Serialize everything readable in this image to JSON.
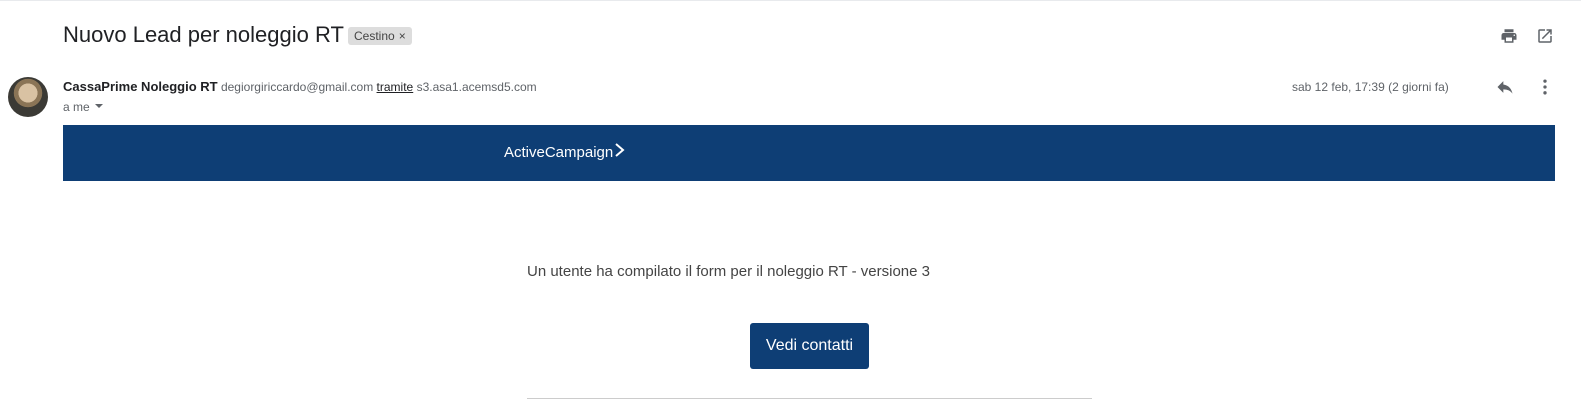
{
  "email": {
    "subject": "Nuovo Lead per noleggio RT",
    "label": "Cestino",
    "label_remove": "×",
    "sender": {
      "name": "CassaPrime Noleggio RT",
      "email": "degiorgiriccardo@gmail.com",
      "via_label": "tramite",
      "via_domain": "s3.asa1.acemsd5.com"
    },
    "recipient": "a me",
    "date": "sab 12 feb, 17:39 (2 giorni fa)"
  },
  "toolbar": {
    "print_icon": "print-icon",
    "open_new_window_icon": "open-in-new-window-icon",
    "reply_icon": "reply-icon",
    "more_icon": "more-vert-icon"
  },
  "message": {
    "brand": "ActiveCampaign",
    "brand_mark": ">",
    "text": "Un utente ha compilato il form per il noleggio RT - versione 3",
    "button_label": "Vedi contatti",
    "brand_color": "#0e3e75"
  }
}
